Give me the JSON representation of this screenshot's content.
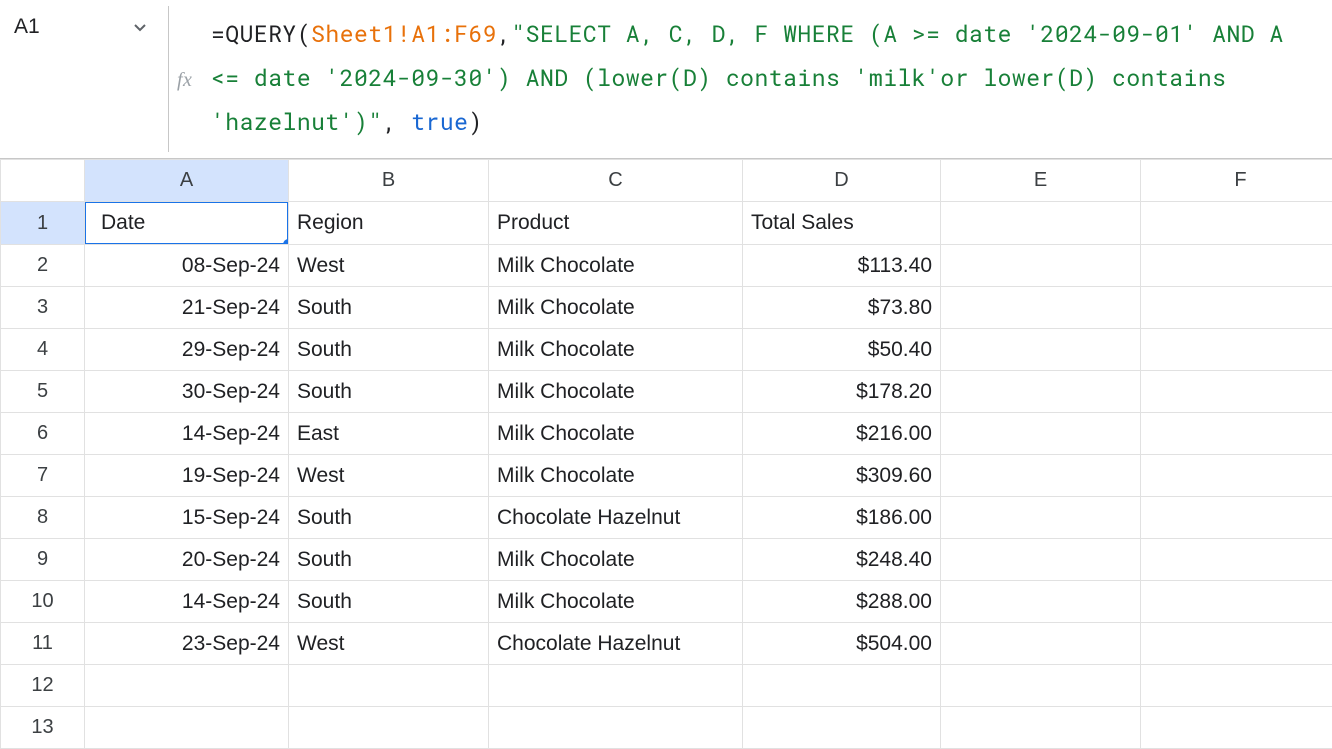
{
  "namebox": {
    "value": "A1"
  },
  "formula": {
    "tokens": [
      {
        "cls": "tok-black",
        "t": "=QUERY("
      },
      {
        "cls": "tok-orange",
        "t": "Sheet1!A1:F69"
      },
      {
        "cls": "tok-black",
        "t": ","
      },
      {
        "cls": "tok-green",
        "t": "\"SELECT A, C, D, F WHERE (A >= date '2024-09-01' AND A <= date '2024-09-30') AND (lower(D) contains 'milk'or lower(D) contains 'hazelnut')\""
      },
      {
        "cls": "tok-black",
        "t": ", "
      },
      {
        "cls": "tok-blue",
        "t": "true"
      },
      {
        "cls": "tok-black",
        "t": ")"
      }
    ]
  },
  "columns": [
    "A",
    "B",
    "C",
    "D",
    "E",
    "F"
  ],
  "row_count": 13,
  "headers": {
    "A": "Date",
    "B": "Region",
    "C": "Product",
    "D": "Total Sales"
  },
  "rows": [
    {
      "A": "08-Sep-24",
      "B": "West",
      "C": "Milk Chocolate",
      "D": "$113.40"
    },
    {
      "A": "21-Sep-24",
      "B": "South",
      "C": "Milk Chocolate",
      "D": "$73.80"
    },
    {
      "A": "29-Sep-24",
      "B": "South",
      "C": "Milk Chocolate",
      "D": "$50.40"
    },
    {
      "A": "30-Sep-24",
      "B": "South",
      "C": "Milk Chocolate",
      "D": "$178.20"
    },
    {
      "A": "14-Sep-24",
      "B": "East",
      "C": "Milk Chocolate",
      "D": "$216.00"
    },
    {
      "A": "19-Sep-24",
      "B": "West",
      "C": "Milk Chocolate",
      "D": "$309.60"
    },
    {
      "A": "15-Sep-24",
      "B": "South",
      "C": "Chocolate Hazelnut",
      "D": "$186.00"
    },
    {
      "A": "20-Sep-24",
      "B": "South",
      "C": "Milk Chocolate",
      "D": "$248.40"
    },
    {
      "A": "14-Sep-24",
      "B": "South",
      "C": "Milk Chocolate",
      "D": "$288.00"
    },
    {
      "A": "23-Sep-24",
      "B": "West",
      "C": "Chocolate Hazelnut",
      "D": "$504.00"
    }
  ],
  "selected_cell": "A1",
  "selected_col": "A",
  "selected_row": 1
}
